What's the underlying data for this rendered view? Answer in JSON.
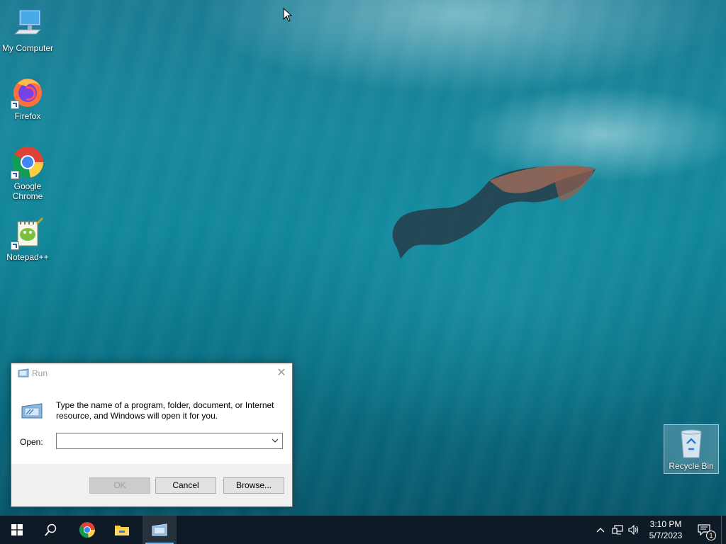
{
  "desktop": {
    "icons": [
      {
        "label": "My Computer",
        "icon": "computer-icon"
      },
      {
        "label": "Firefox",
        "icon": "firefox-icon"
      },
      {
        "label": "Google Chrome",
        "icon": "chrome-icon"
      },
      {
        "label": "Notepad++",
        "icon": "notepadpp-icon"
      }
    ],
    "recycle_bin": {
      "label": "Recycle Bin",
      "icon": "recycle-bin-icon"
    }
  },
  "run_dialog": {
    "title": "Run",
    "description": "Type the name of a program, folder, document, or Internet resource, and Windows will open it for you.",
    "open_label": "Open:",
    "open_value": "",
    "ok_label": "OK",
    "cancel_label": "Cancel",
    "browse_label": "Browse..."
  },
  "taskbar": {
    "pinned": [
      {
        "icon": "windows-start-icon"
      },
      {
        "icon": "search-icon"
      },
      {
        "icon": "chrome-icon"
      },
      {
        "icon": "file-explorer-icon"
      },
      {
        "icon": "run-app-icon",
        "active": true
      }
    ],
    "tray": [
      "chevron-up-icon",
      "network-icon",
      "volume-icon"
    ],
    "clock": {
      "time": "3:10 PM",
      "date": "5/7/2023"
    },
    "notifications": {
      "count": "1"
    }
  },
  "colors": {
    "taskbar": "#0e1a26",
    "accent": "#76b9ed",
    "water": "#10869a"
  }
}
